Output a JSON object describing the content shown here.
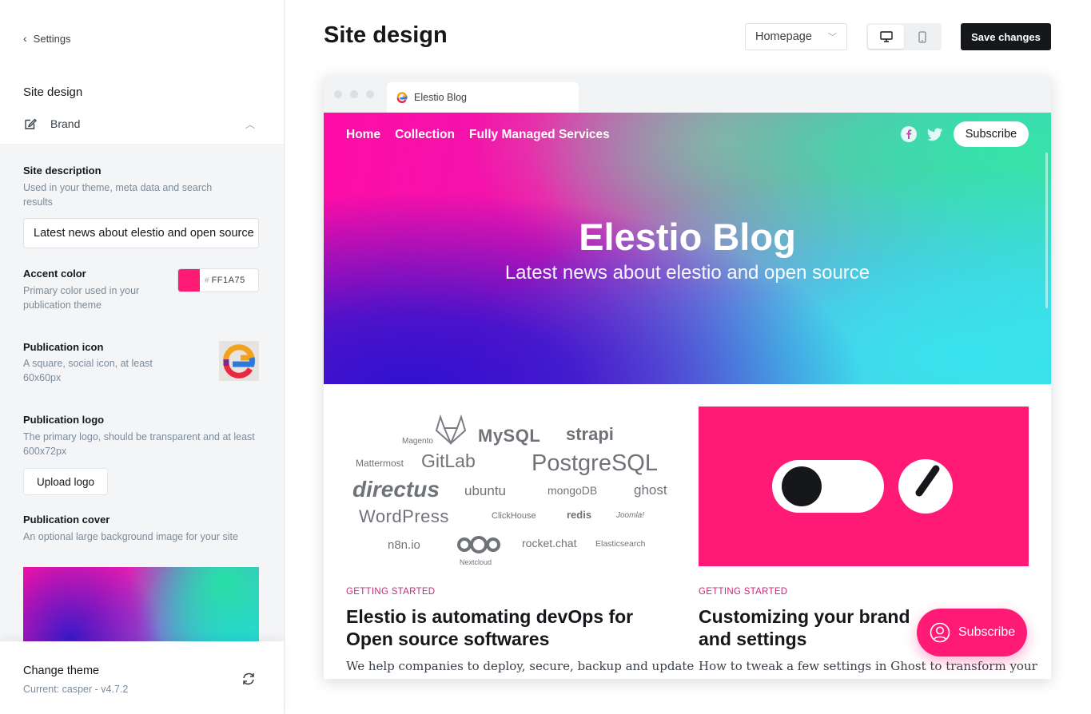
{
  "sidebar": {
    "back_label": "Settings",
    "section_title": "Site design",
    "brand_label": "Brand",
    "site_description": {
      "title": "Site description",
      "help": "Used in your theme, meta data and search results",
      "value": "Latest news about elestio and open source"
    },
    "accent_color": {
      "title": "Accent color",
      "help": "Primary color used in your publication theme",
      "hash": "#",
      "value": "FF1A75",
      "swatch": "#ff1a75"
    },
    "publication_icon": {
      "title": "Publication icon",
      "help": "A square, social icon, at least 60x60px"
    },
    "publication_logo": {
      "title": "Publication logo",
      "help": "The primary logo, should be transparent and at least 600x72px",
      "button": "Upload logo"
    },
    "publication_cover": {
      "title": "Publication cover",
      "help": "An optional large background image for your site"
    },
    "theme": {
      "title": "Change theme",
      "current": "Current: casper - v4.7.2"
    }
  },
  "header": {
    "title": "Site design",
    "page_select": "Homepage",
    "save_label": "Save changes"
  },
  "preview": {
    "tab_title": "Elestio Blog",
    "nav": [
      "Home",
      "Collection",
      "Fully Managed Services"
    ],
    "subscribe_label": "Subscribe",
    "site_title": "Elestio Blog",
    "site_description": "Latest news about elestio and open source",
    "logos": {
      "magento": "Magento",
      "mysql": "MySQL",
      "strapi": "strapi",
      "mattermost": "Mattermost",
      "gitlab": "GitLab",
      "postgresql": "PostgreSQL",
      "directus": "directus",
      "ubuntu": "ubuntu",
      "mongodb": "mongoDB",
      "ghost": "ghost",
      "wordpress": "WordPress",
      "clickhouse": "ClickHouse",
      "redis": "redis",
      "joomla": "Joomla!",
      "n8n": "n8n.io",
      "nextcloud": "Nextcloud",
      "rocketchat": "rocket.chat",
      "elasticsearch": "Elasticsearch"
    },
    "posts": [
      {
        "tag": "GETTING STARTED",
        "title": "Elestio is automating devOps for Open source softwares",
        "excerpt": "We help companies to deploy, secure, backup and update"
      },
      {
        "tag": "GETTING STARTED",
        "title": "Customizing your brand and settings",
        "excerpt": "How to tweak a few settings in Ghost to transform your"
      }
    ],
    "portal_label": "Subscribe"
  }
}
